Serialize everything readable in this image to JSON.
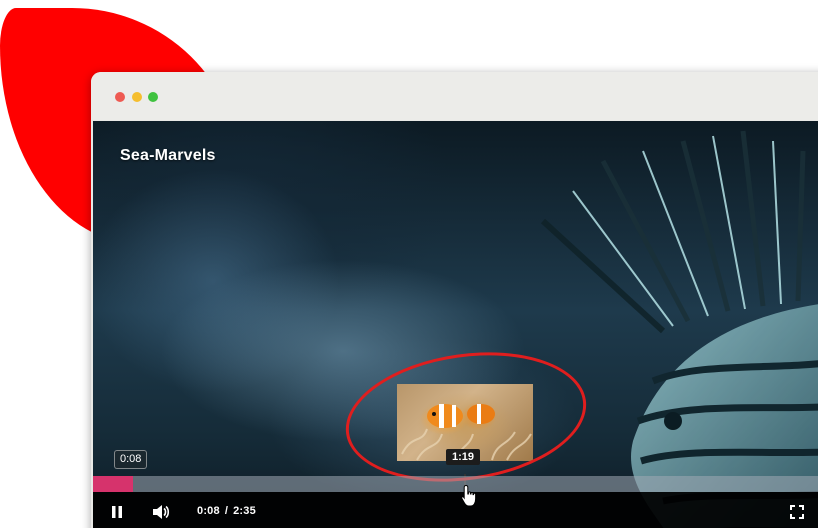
{
  "video": {
    "title": "Sea-Marvels",
    "elapsed_tooltip": "0:08",
    "preview_time": "1:19",
    "current_time": "0:08",
    "time_separator": "/",
    "duration": "2:35",
    "progress_fraction": 0.054,
    "accent_color": "#d6336c"
  },
  "window": {
    "dot_colors": [
      "#ee5a52",
      "#f5be2e",
      "#3fc23f"
    ]
  },
  "icons": {
    "pause": "pause-icon",
    "volume": "volume-icon",
    "fullscreen": "fullscreen-icon",
    "cursor": "hand-cursor-icon"
  }
}
